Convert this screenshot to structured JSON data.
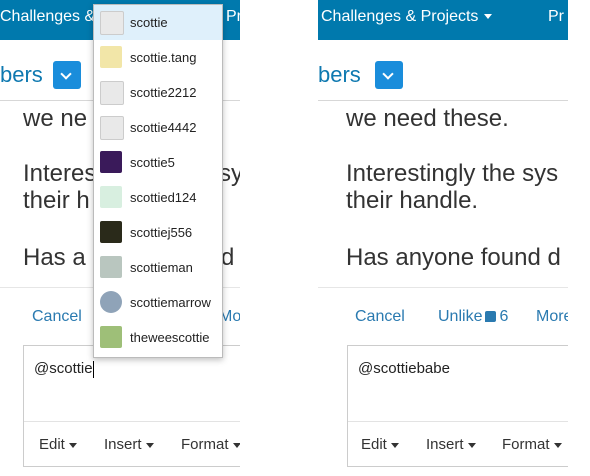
{
  "left": {
    "nav": {
      "challenges_label": "Challenges &",
      "projects_label": "Pr"
    },
    "subtitle": "bers",
    "post": {
      "line1": "we ne",
      "line2a": "Interes",
      "line2b": "sy",
      "line3": "their h",
      "line4a": "Has a",
      "line4b": "d"
    },
    "actions": {
      "cancel": "Cancel",
      "more": "Mor"
    },
    "editor": {
      "value": "@scottie"
    },
    "toolbar": {
      "edit": "Edit",
      "insert": "Insert",
      "format": "Format"
    },
    "mentions": [
      {
        "name": "scottie",
        "avatar": "default-avatar-icon",
        "selected": true
      },
      {
        "name": "scottie.tang",
        "avatar": "dog-avatar-icon",
        "selected": false
      },
      {
        "name": "scottie2212",
        "avatar": "default-avatar-icon",
        "selected": false
      },
      {
        "name": "scottie4442",
        "avatar": "default-avatar-icon",
        "selected": false
      },
      {
        "name": "scottie5",
        "avatar": "star-avatar-icon",
        "selected": false
      },
      {
        "name": "scottied124",
        "avatar": "chip-avatar-icon",
        "selected": false
      },
      {
        "name": "scottiej556",
        "avatar": "photo-avatar-icon",
        "selected": false
      },
      {
        "name": "scottieman",
        "avatar": "block-avatar-icon",
        "selected": false
      },
      {
        "name": "scottiemarrow",
        "avatar": "globe-avatar-icon",
        "selected": false
      },
      {
        "name": "theweescottie",
        "avatar": "book-avatar-icon",
        "selected": false
      }
    ]
  },
  "right": {
    "nav": {
      "challenges_label": "Challenges & Projects",
      "projects_label": "Pr"
    },
    "subtitle": "bers",
    "post": {
      "line1": "we need these.",
      "line2": "Interestingly the sys",
      "line3": "their handle.",
      "line4": "Has anyone found d"
    },
    "actions": {
      "cancel": "Cancel",
      "unlike": "Unlike",
      "like_count": "6",
      "more": "More"
    },
    "editor": {
      "value": "@scottiebabe"
    },
    "toolbar": {
      "edit": "Edit",
      "insert": "Insert",
      "format": "Format"
    }
  },
  "colors": {
    "nav_bg": "#0079ad",
    "accent": "#1a8ddb",
    "link": "#2a7ab0",
    "selected_bg": "#dff0fb"
  }
}
